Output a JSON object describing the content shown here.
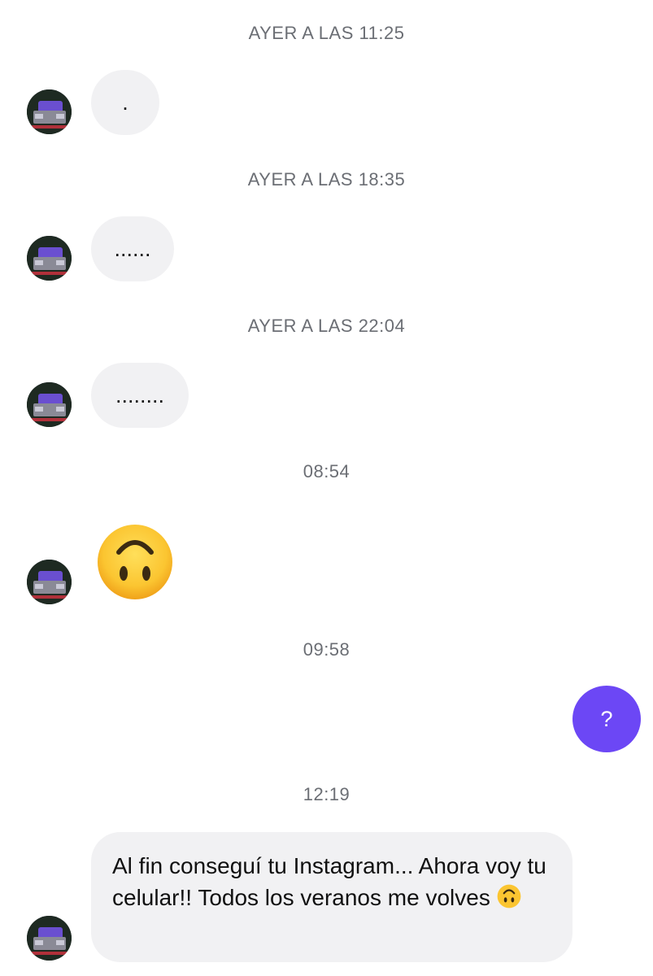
{
  "conversation": {
    "timestamps": [
      "AYER A LAS 11:25",
      "AYER A LAS 18:35",
      "AYER A LAS 22:04",
      "08:54",
      "09:58",
      "12:19"
    ],
    "messages": [
      {
        "direction": "incoming",
        "text": "."
      },
      {
        "direction": "incoming",
        "text": "......"
      },
      {
        "direction": "incoming",
        "text": "........"
      },
      {
        "direction": "incoming",
        "emoji": "upside-down-face-icon"
      },
      {
        "direction": "outgoing",
        "text": "?"
      },
      {
        "direction": "incoming",
        "text": "Al fin conseguí tu Instagram... Ahora voy tu celular!! Todos los veranos me volves"
      }
    ]
  },
  "colors": {
    "incoming_bubble": "#f1f1f3",
    "outgoing_bubble": "#6c47f5",
    "timestamp": "#6b6e74",
    "emoji_face": "#fbc531"
  }
}
